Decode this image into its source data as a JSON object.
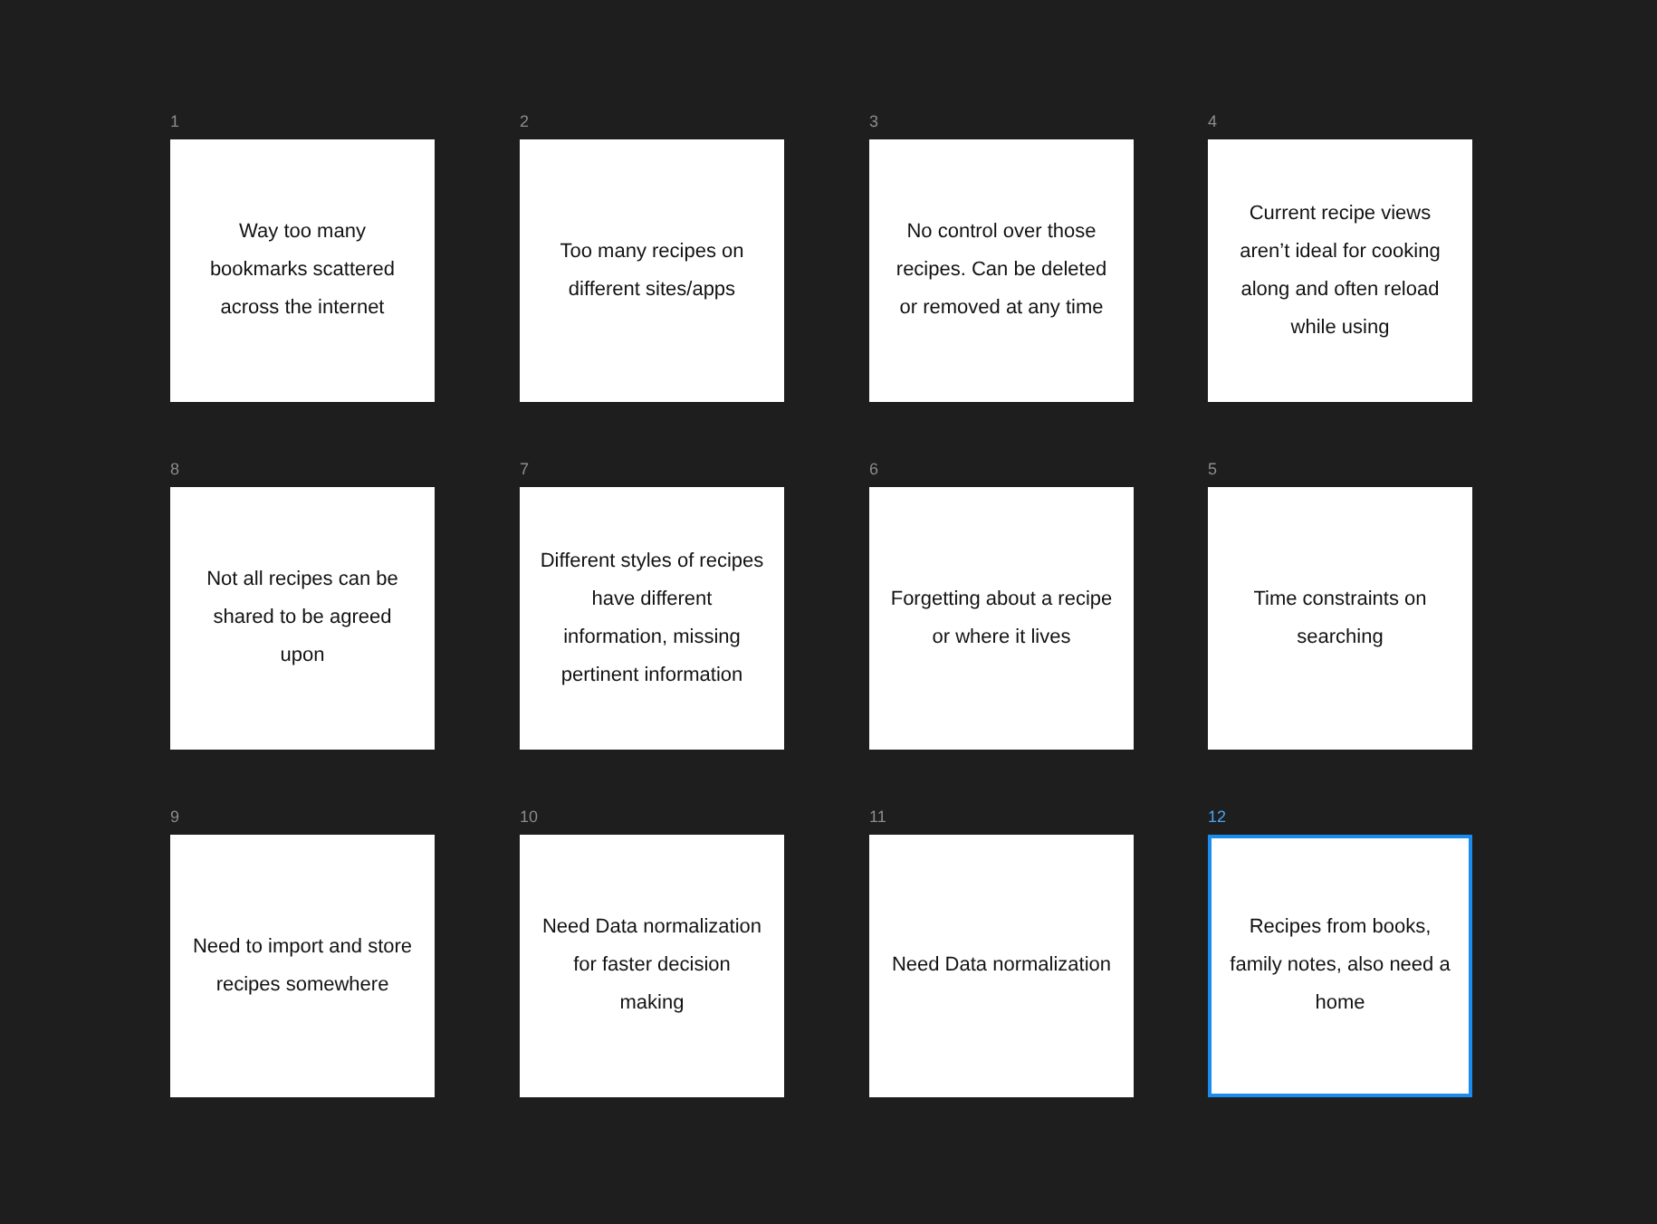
{
  "frames": [
    {
      "label": "1",
      "text": "Way too many bookmarks scattered across the internet",
      "selected": false
    },
    {
      "label": "2",
      "text": "Too many recipes on different sites/apps",
      "selected": false
    },
    {
      "label": "3",
      "text": "No control over those recipes. Can be deleted or removed at any time",
      "selected": false
    },
    {
      "label": "4",
      "text": "Current recipe views aren’t ideal for cooking along and often reload while using",
      "selected": false
    },
    {
      "label": "8",
      "text": "Not all recipes can be shared to be agreed upon",
      "selected": false
    },
    {
      "label": "7",
      "text": "Different styles of recipes have different information, missing pertinent information",
      "selected": false
    },
    {
      "label": "6",
      "text": "Forgetting about a recipe or where it lives",
      "selected": false
    },
    {
      "label": "5",
      "text": "Time constraints on searching",
      "selected": false
    },
    {
      "label": "9",
      "text": "Need to import and store recipes somewhere",
      "selected": false
    },
    {
      "label": "10",
      "text": "Need Data normalization for faster decision making",
      "selected": false
    },
    {
      "label": "11",
      "text": "Need Data normalization",
      "selected": false
    },
    {
      "label": "12",
      "text": "Recipes from books, family notes, also need a home",
      "selected": true
    }
  ]
}
